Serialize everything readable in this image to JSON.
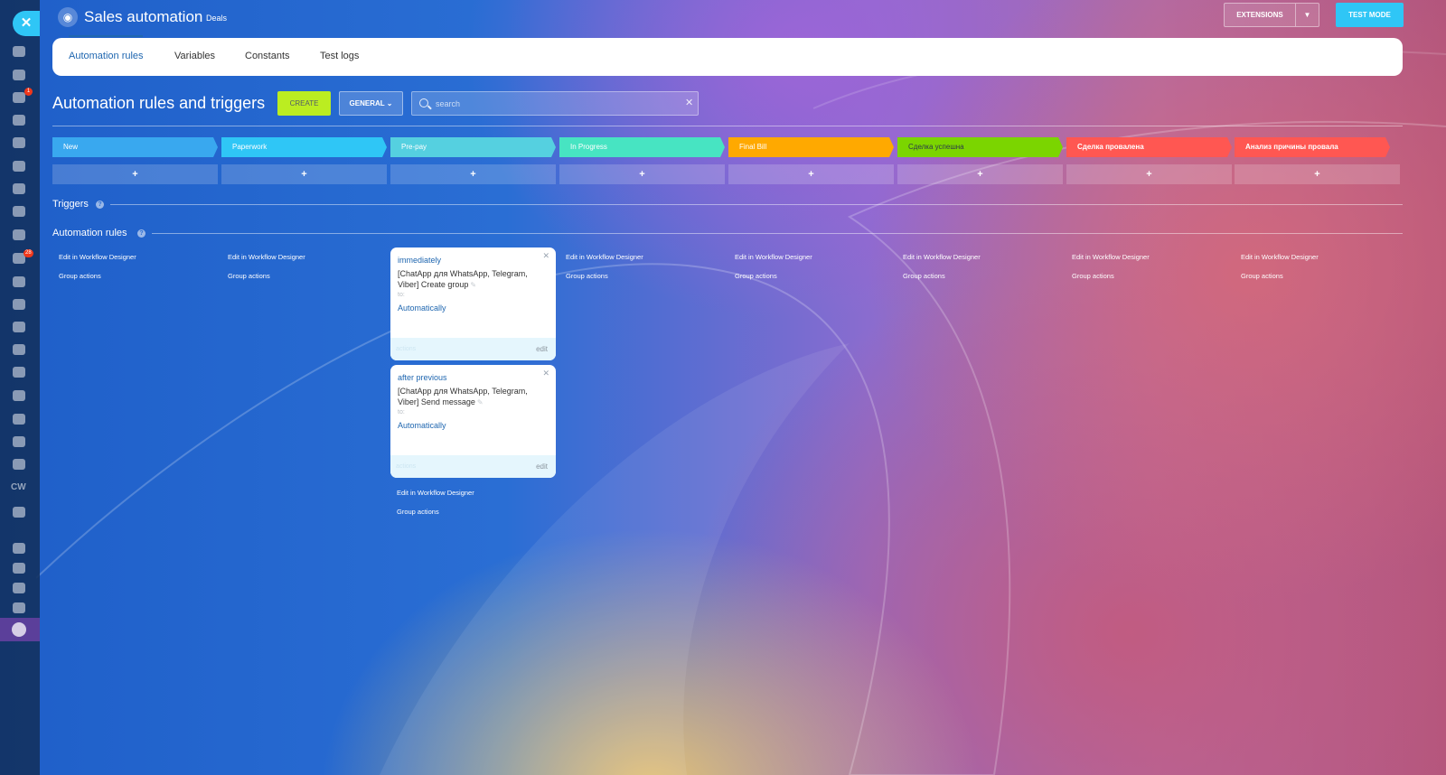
{
  "header": {
    "title": "Sales automation",
    "subtitle": "Deals",
    "extensions_label": "EXTENSIONS",
    "test_mode_label": "TEST MODE"
  },
  "tabs": [
    {
      "label": "Automation rules",
      "active": true
    },
    {
      "label": "Variables",
      "active": false
    },
    {
      "label": "Constants",
      "active": false
    },
    {
      "label": "Test logs",
      "active": false
    }
  ],
  "toolbar": {
    "page_title": "Automation rules and triggers",
    "create_label": "CREATE",
    "general_label": "GENERAL",
    "search_placeholder": "search"
  },
  "stages": [
    {
      "name": "New",
      "color": "#39a8ef"
    },
    {
      "name": "Paperwork",
      "color": "#2fc6f6"
    },
    {
      "name": "Pre-pay",
      "color": "#55d0e0"
    },
    {
      "name": "In Progress",
      "color": "#47e4c2"
    },
    {
      "name": "Final Bill",
      "color": "#ffa900"
    },
    {
      "name": "Сделка успешна",
      "color": "#7bd500"
    },
    {
      "name": "Сделка провалена",
      "color": "#ff5752"
    },
    {
      "name": "Анализ причины провала",
      "color": "#ff5752"
    }
  ],
  "add_label": "+",
  "sections": {
    "triggers": "Triggers",
    "automation_rules": "Automation rules"
  },
  "column_links": {
    "edit": "Edit in Workflow Designer",
    "group": "Group actions"
  },
  "rules": [
    {
      "when": "immediately",
      "name": "[ChatApp для WhatsApp, Telegram, Viber] Create group",
      "to": "to:",
      "responsible": "Automatically",
      "actions": "actions",
      "edit": "edit"
    },
    {
      "when": "after previous",
      "name": "[ChatApp для WhatsApp, Telegram, Viber] Send message",
      "to": "to:",
      "responsible": "Automatically",
      "actions": "actions",
      "edit": "edit"
    }
  ],
  "sidebar": {
    "cw_label": "CW",
    "badge_chat": "1",
    "badge_feed": "28"
  }
}
